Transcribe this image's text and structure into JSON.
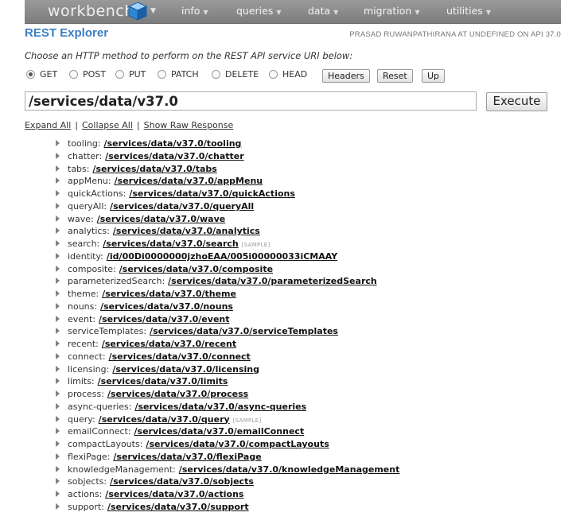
{
  "nav": {
    "brand": "workbench",
    "items": [
      {
        "label": "info"
      },
      {
        "label": "queries"
      },
      {
        "label": "data"
      },
      {
        "label": "migration"
      },
      {
        "label": "utilities"
      }
    ]
  },
  "page": {
    "title": "REST Explorer",
    "user_info": "PRASAD RUWANPATHIRANA AT UNDEFINED ON API 37.0",
    "instructions": "Choose an HTTP method to perform on the REST API service URI below:"
  },
  "methods": [
    {
      "label": "GET",
      "checked": true
    },
    {
      "label": "POST",
      "checked": false
    },
    {
      "label": "PUT",
      "checked": false
    },
    {
      "label": "PATCH",
      "checked": false
    },
    {
      "label": "DELETE",
      "checked": false
    },
    {
      "label": "HEAD",
      "checked": false
    }
  ],
  "buttons": {
    "headers": "Headers",
    "reset": "Reset",
    "up": "Up",
    "execute": "Execute"
  },
  "uri": {
    "value": "/services/data/v37.0"
  },
  "links": {
    "expand_all": "Expand All",
    "collapse_all": "Collapse All",
    "show_raw": "Show Raw Response",
    "separator": "|"
  },
  "tree": [
    {
      "key": "tooling:",
      "url": "/services/data/v37.0/tooling"
    },
    {
      "key": "chatter:",
      "url": "/services/data/v37.0/chatter"
    },
    {
      "key": "tabs:",
      "url": "/services/data/v37.0/tabs"
    },
    {
      "key": "appMenu:",
      "url": "/services/data/v37.0/appMenu"
    },
    {
      "key": "quickActions:",
      "url": "/services/data/v37.0/quickActions"
    },
    {
      "key": "queryAll:",
      "url": "/services/data/v37.0/queryAll"
    },
    {
      "key": "wave:",
      "url": "/services/data/v37.0/wave"
    },
    {
      "key": "analytics:",
      "url": "/services/data/v37.0/analytics"
    },
    {
      "key": "search:",
      "url": "/services/data/v37.0/search",
      "sample": "[SAMPLE]"
    },
    {
      "key": "identity:",
      "url": "/id/00Di0000000jzhoEAA/005i00000033iCMAAY"
    },
    {
      "key": "composite:",
      "url": "/services/data/v37.0/composite"
    },
    {
      "key": "parameterizedSearch:",
      "url": "/services/data/v37.0/parameterizedSearch"
    },
    {
      "key": "theme:",
      "url": "/services/data/v37.0/theme"
    },
    {
      "key": "nouns:",
      "url": "/services/data/v37.0/nouns"
    },
    {
      "key": "event:",
      "url": "/services/data/v37.0/event"
    },
    {
      "key": "serviceTemplates:",
      "url": "/services/data/v37.0/serviceTemplates"
    },
    {
      "key": "recent:",
      "url": "/services/data/v37.0/recent"
    },
    {
      "key": "connect:",
      "url": "/services/data/v37.0/connect"
    },
    {
      "key": "licensing:",
      "url": "/services/data/v37.0/licensing"
    },
    {
      "key": "limits:",
      "url": "/services/data/v37.0/limits"
    },
    {
      "key": "process:",
      "url": "/services/data/v37.0/process"
    },
    {
      "key": "async-queries:",
      "url": "/services/data/v37.0/async-queries"
    },
    {
      "key": "query:",
      "url": "/services/data/v37.0/query",
      "sample": "[SAMPLE]"
    },
    {
      "key": "emailConnect:",
      "url": "/services/data/v37.0/emailConnect"
    },
    {
      "key": "compactLayouts:",
      "url": "/services/data/v37.0/compactLayouts"
    },
    {
      "key": "flexiPage:",
      "url": "/services/data/v37.0/flexiPage"
    },
    {
      "key": "knowledgeManagement:",
      "url": "/services/data/v37.0/knowledgeManagement"
    },
    {
      "key": "sobjects:",
      "url": "/services/data/v37.0/sobjects"
    },
    {
      "key": "actions:",
      "url": "/services/data/v37.0/actions"
    },
    {
      "key": "support:",
      "url": "/services/data/v37.0/support"
    }
  ]
}
